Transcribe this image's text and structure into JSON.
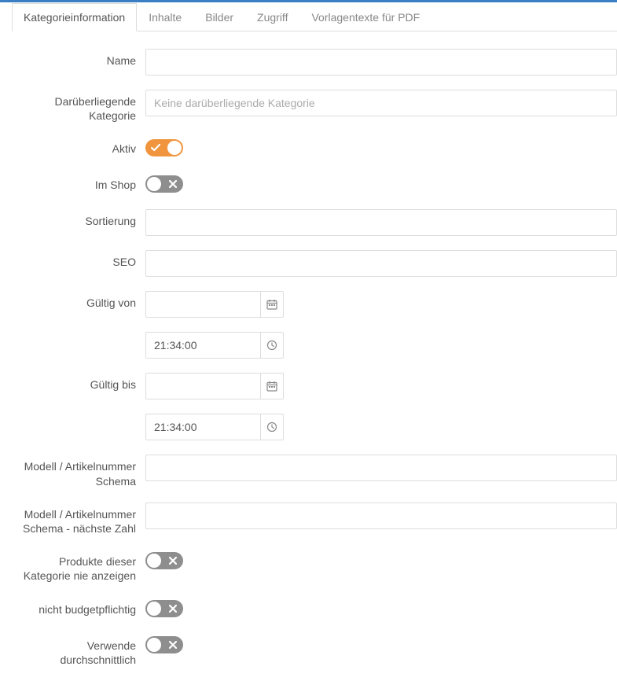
{
  "tabs": [
    {
      "label": "Kategorieinformation",
      "active": true
    },
    {
      "label": "Inhalte",
      "active": false
    },
    {
      "label": "Bilder",
      "active": false
    },
    {
      "label": "Zugriff",
      "active": false
    },
    {
      "label": "Vorlagentexte für PDF",
      "active": false
    }
  ],
  "form": {
    "name_label": "Name",
    "name_value": "",
    "parent_label": "Darüberliegende Kategorie",
    "parent_placeholder": "Keine darüberliegende Kategorie",
    "parent_value": "",
    "active_label": "Aktiv",
    "active_value": true,
    "in_shop_label": "Im Shop",
    "in_shop_value": false,
    "sort_label": "Sortierung",
    "sort_value": "",
    "seo_label": "SEO",
    "seo_value": "",
    "valid_from_label": "Gültig von",
    "valid_from_date": "",
    "valid_from_time": "21:34:00",
    "valid_to_label": "Gültig bis",
    "valid_to_date": "",
    "valid_to_time": "21:34:00",
    "model_schema_label": "Modell / Artikelnummer Schema",
    "model_schema_value": "",
    "model_schema_next_label": "Modell / Artikelnummer Schema - nächste Zahl",
    "model_schema_next_value": "",
    "never_show_label": "Produkte dieser Kategorie nie anzeigen",
    "never_show_value": false,
    "not_budget_label": "nicht budgetpflichtig",
    "not_budget_value": false,
    "use_avg_label": "Verwende durchschnittlich",
    "use_avg_value": false
  }
}
